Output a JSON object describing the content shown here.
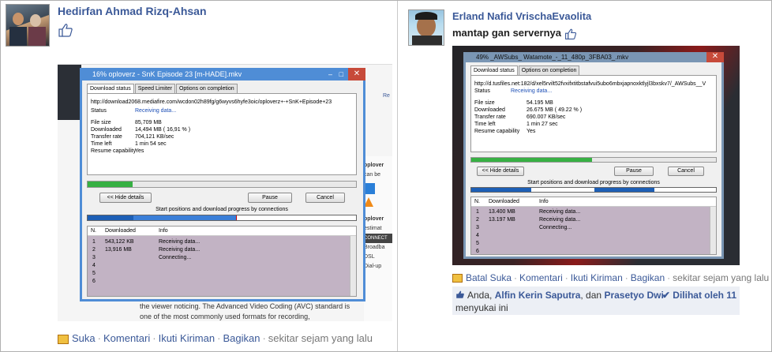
{
  "post1": {
    "author": "Hedirfan Ahmad Rizq-Ahsan",
    "actions": {
      "like": "Suka",
      "comment": "Komentari",
      "follow": "Ikuti Kiriman",
      "share": "Bagikan",
      "time": "sekitar sejam yang lalu"
    },
    "dialog": {
      "title": "16% oploverz - SnK Episode 23 [m-HADE].mkv",
      "tabs": [
        "Download status",
        "Speed Limiter",
        "Options on completion"
      ],
      "url": "http://download2068.mediafire.com/wcdon02h89fg/g6wyvs6hyfe3oic/oploverz+-+SnK+Episode+23",
      "status_label": "Status",
      "status_value": "Receiving data...",
      "file_size_label": "File size",
      "file_size": "85,709  MB",
      "downloaded_label": "Downloaded",
      "downloaded": "14,494  MB  ( 16,91 % )",
      "rate_label": "Transfer rate",
      "rate": "704,121  KB/sec",
      "time_left_label": "Time left",
      "time_left": "1 min 54 sec",
      "resume_label": "Resume capability",
      "resume": "Yes",
      "progress": 0.1691,
      "hide_button": "<< Hide details",
      "pause_button": "Pause",
      "cancel_button": "Cancel",
      "connections_label": "Start positions and download progress by connections",
      "table_headers": [
        "N.",
        "Downloaded",
        "Info"
      ],
      "rows": [
        {
          "n": "1",
          "downloaded": "543,122  KB",
          "info": "Receiving data..."
        },
        {
          "n": "2",
          "downloaded": "13,916  MB",
          "info": "Receiving data..."
        },
        {
          "n": "3",
          "downloaded": "",
          "info": "Connecting..."
        },
        {
          "n": "4",
          "downloaded": "",
          "info": ""
        },
        {
          "n": "5",
          "downloaded": "",
          "info": ""
        },
        {
          "n": "6",
          "downloaded": "",
          "info": ""
        }
      ]
    },
    "bg_text": {
      "line1": "the viewer noticing. The Advanced Video Coding (AVC) standard is",
      "line2": "one of the most commonly used formats for recording,",
      "side": [
        "oplover",
        "can be",
        "oplover",
        "estimat",
        "CONNECT",
        "Broadba",
        "DSL",
        "Dial-up"
      ],
      "top_right": "Re"
    }
  },
  "post2": {
    "author": "Erland Nafid VrischaEvaolita",
    "message": "mantap gan servernya",
    "actions": {
      "unlike": "Batal Suka",
      "comment": "Komentari",
      "follow": "Ikuti Kiriman",
      "share": "Bagikan",
      "time": "sekitar sejam yang lalu"
    },
    "likes": {
      "you": "Anda,",
      "friend": "Alfin Kerin Saputra",
      "and": ", dan",
      "friend2": "Prasetyo Dwi",
      "suffix": "menyukai ini",
      "seen": "Dilihat oleh 11"
    },
    "dialog": {
      "title": "49% _AWSubs_ Watamote_-_11_480p_3FBA03_.mkv",
      "tabs": [
        "Download status",
        "Options on completion"
      ],
      "url": "http://d.tusfiles.net:182/d/xel5rvilt52fvxifxtitbstafvui5ubo6mbxjapnoxktlyjl3bxskv7/_AWSubs__V",
      "status_label": "Status",
      "status_value": "Receiving data...",
      "file_size_label": "File size",
      "file_size": "54.195  MB",
      "downloaded_label": "Downloaded",
      "downloaded": "26.675  MB  ( 49.22 % )",
      "rate_label": "Transfer rate",
      "rate": "690.007  KB/sec",
      "time_left_label": "Time left",
      "time_left": "1 min 27 sec",
      "resume_label": "Resume capability",
      "resume": "Yes",
      "progress": 0.4922,
      "hide_button": "<< Hide details",
      "pause_button": "Pause",
      "cancel_button": "Cancel",
      "connections_label": "Start positions and download progress by connections",
      "table_headers": [
        "N.",
        "Downloaded",
        "Info"
      ],
      "rows": [
        {
          "n": "1",
          "downloaded": "13.400  MB",
          "info": "Receiving data..."
        },
        {
          "n": "2",
          "downloaded": "13.197  MB",
          "info": "Receiving data..."
        },
        {
          "n": "3",
          "downloaded": "",
          "info": "Connecting..."
        },
        {
          "n": "4",
          "downloaded": "",
          "info": ""
        },
        {
          "n": "5",
          "downloaded": "",
          "info": ""
        },
        {
          "n": "6",
          "downloaded": "",
          "info": ""
        }
      ]
    }
  },
  "colors": {
    "link": "#3b5998",
    "titlebar": "#4f8dd6",
    "progress": "#37b043",
    "table_bg": "#c2b3c4"
  }
}
